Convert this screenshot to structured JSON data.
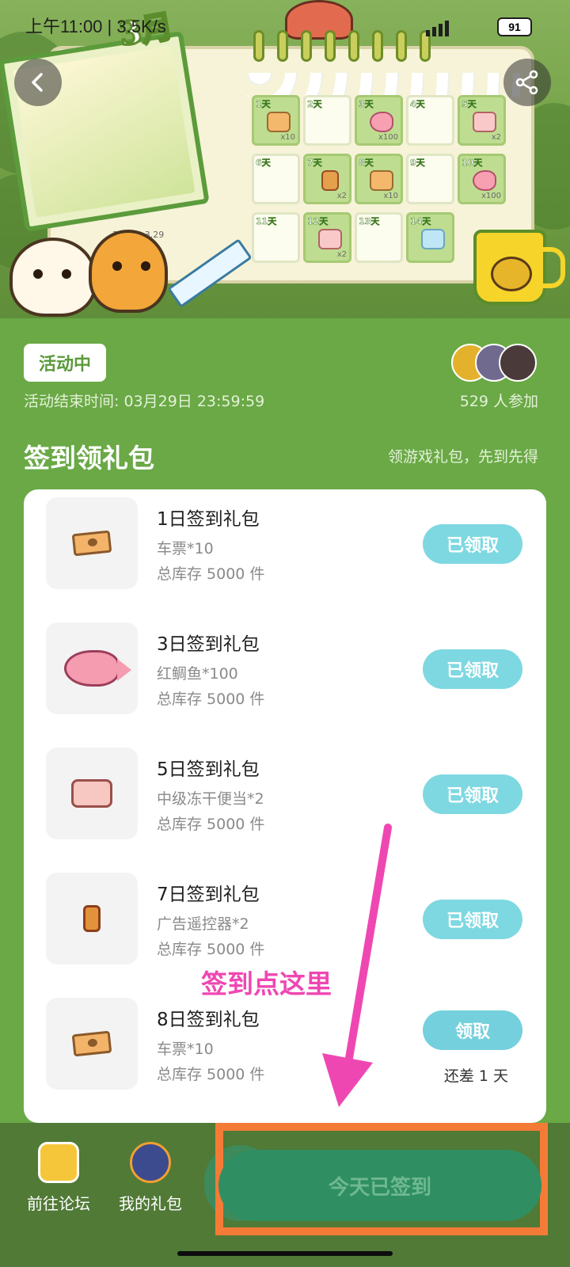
{
  "status_bar": {
    "time_speed": "上午11:00 | 3.5K/s",
    "battery": "91"
  },
  "banner": {
    "month_title": "3月",
    "date_range": "3.16 ~ 3.29",
    "calendar": [
      {
        "day": "1天",
        "item": "ticket",
        "qty": "x10"
      },
      {
        "day": "2天",
        "item": "",
        "qty": ""
      },
      {
        "day": "3天",
        "item": "fish",
        "qty": "x100"
      },
      {
        "day": "4天",
        "item": "",
        "qty": ""
      },
      {
        "day": "5天",
        "item": "bento",
        "qty": "x2"
      },
      {
        "day": "6天",
        "item": "",
        "qty": ""
      },
      {
        "day": "7天",
        "item": "remote",
        "qty": "x2"
      },
      {
        "day": "8天",
        "item": "ticket",
        "qty": "x10"
      },
      {
        "day": "9天",
        "item": "",
        "qty": ""
      },
      {
        "day": "10天",
        "item": "fish",
        "qty": "x100"
      },
      {
        "day": "11天",
        "item": "",
        "qty": ""
      },
      {
        "day": "12天",
        "item": "bento",
        "qty": "x2"
      },
      {
        "day": "13天",
        "item": "",
        "qty": ""
      },
      {
        "day": "14天",
        "item": "pass",
        "qty": ""
      }
    ]
  },
  "event": {
    "status": "活动中",
    "end_time": "活动结束时间: 03月29日 23:59:59",
    "participants": "529 人参加"
  },
  "section": {
    "title": "签到领礼包",
    "subtitle": "领游戏礼包，先到先得"
  },
  "gifts": [
    {
      "title": "1日签到礼包",
      "item": "车票*10",
      "stock": "总库存 5000 件",
      "button": "已领取",
      "icon": "ticket-icon"
    },
    {
      "title": "3日签到礼包",
      "item": "红鲷鱼*100",
      "stock": "总库存 5000 件",
      "button": "已领取",
      "icon": "fish-icon"
    },
    {
      "title": "5日签到礼包",
      "item": "中级冻干便当*2",
      "stock": "总库存 5000 件",
      "button": "已领取",
      "icon": "bento-icon"
    },
    {
      "title": "7日签到礼包",
      "item": "广告遥控器*2",
      "stock": "总库存 5000 件",
      "button": "已领取",
      "icon": "remote-icon"
    },
    {
      "title": "8日签到礼包",
      "item": "车票*10",
      "stock": "总库存 5000 件",
      "button": "领取",
      "remain": "还差 1 天",
      "icon": "ticket-icon"
    }
  ],
  "annotation": {
    "text": "签到点这里",
    "color": "#ef47b2"
  },
  "bottom_bar": {
    "forum_label": "前往论坛",
    "my_gift_label": "我的礼包",
    "checkin_label": "今天已签到"
  },
  "colors": {
    "page_bg": "#6aa946",
    "claimed_button": "#7ed8e1",
    "checkin_button": "#2f8f62",
    "highlight_box": "#f47b37"
  }
}
